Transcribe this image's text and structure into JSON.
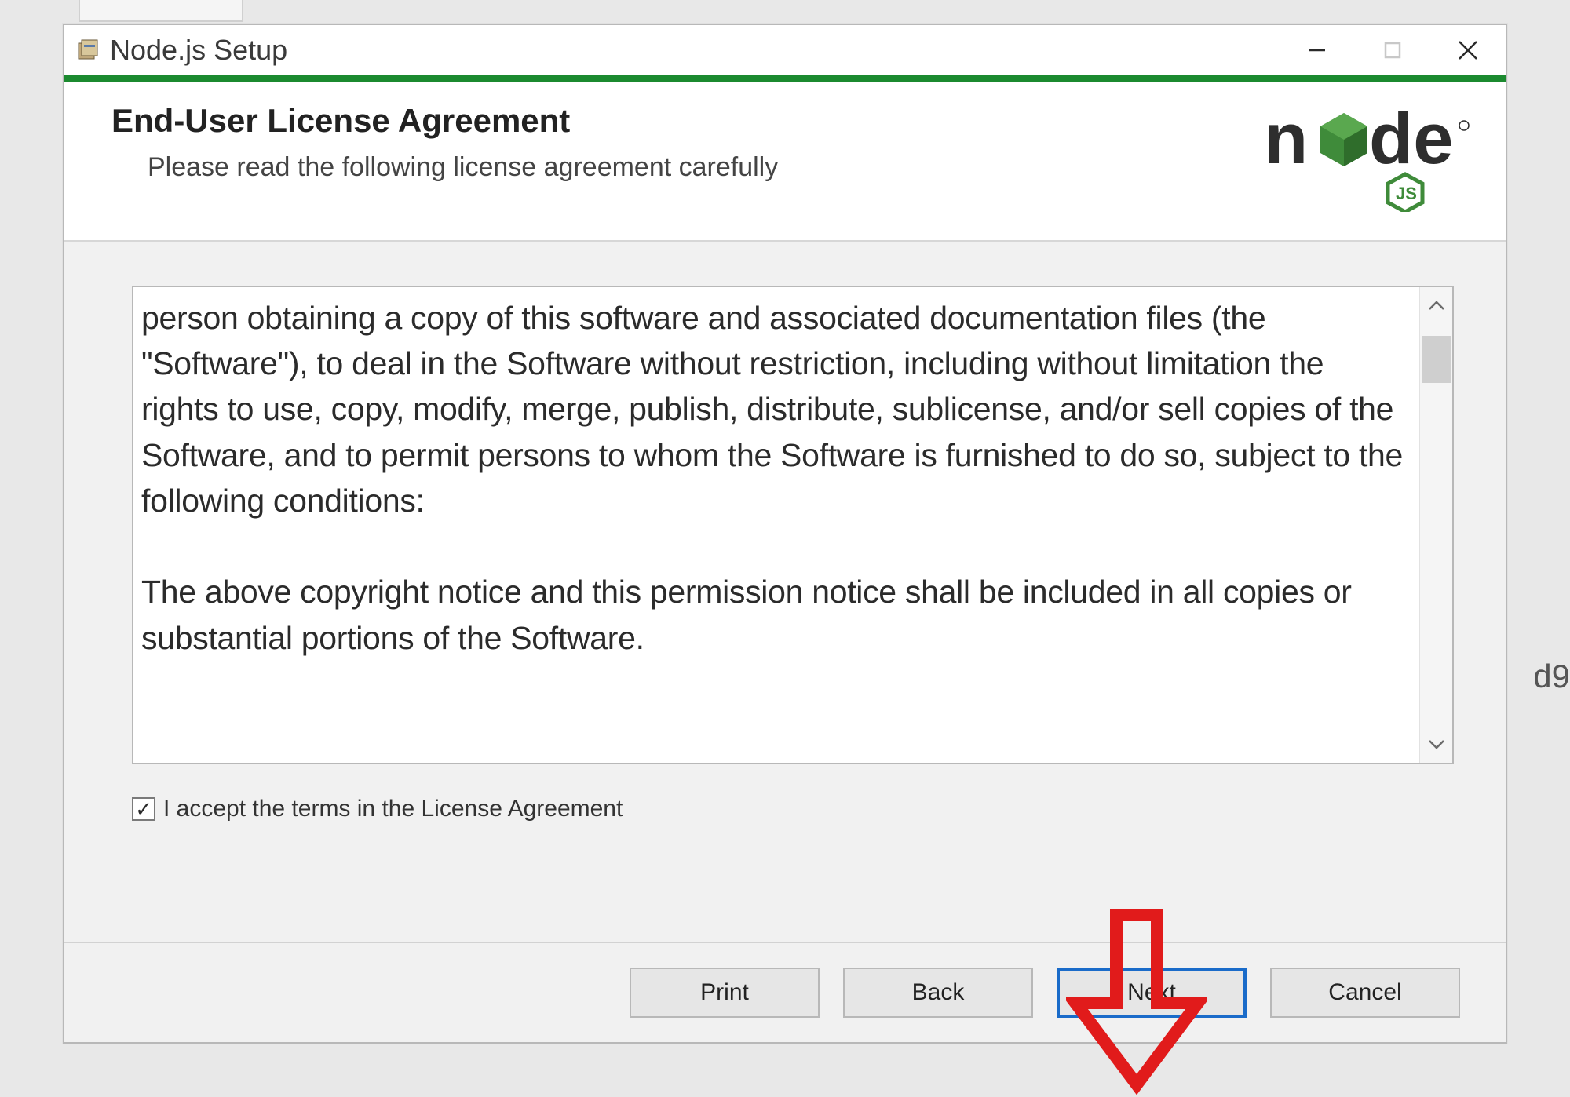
{
  "window": {
    "title": "Node.js Setup"
  },
  "header": {
    "title": "End-User License Agreement",
    "subtitle": "Please read the following license agreement carefully",
    "logo_text_1": "n",
    "logo_text_2": "de",
    "logo_sub": "JS"
  },
  "license": {
    "body_para1": "person obtaining a copy of this software and associated documentation files (the \"Software\"), to deal in the Software without restriction, including without limitation the rights to use, copy, modify, merge, publish, distribute, sublicense, and/or sell copies of the Software, and to permit persons to whom the Software is furnished to do so, subject to the following conditions:",
    "body_para2": "The above copyright notice and this permission notice shall be included in all copies or substantial portions of the Software."
  },
  "accept": {
    "checked": true,
    "label": "I accept the terms in the License Agreement"
  },
  "buttons": {
    "print": "Print",
    "back": "Back",
    "next": "Next",
    "cancel": "Cancel"
  },
  "background": {
    "right_frag": "d9"
  }
}
